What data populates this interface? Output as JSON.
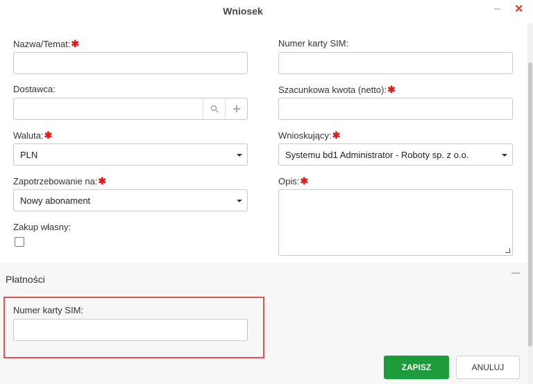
{
  "window": {
    "title": "Wniosek",
    "minimize": "–",
    "close": "✕"
  },
  "form": {
    "nazwa_label": "Nazwa/Temat:",
    "nazwa_value": "",
    "sim_label": "Numer karty SIM:",
    "sim_value": "",
    "dostawca_label": "Dostawca:",
    "dostawca_value": "",
    "kwota_label": "Szacunkowa kwota (netto):",
    "kwota_value": "",
    "waluta_label": "Waluta:",
    "waluta_value": "PLN",
    "wnioskujacy_label": "Wnioskujący:",
    "wnioskujacy_value": "Systemu bd1 Administrator - Roboty sp. z o.o.",
    "zapotrzebowanie_label": "Zapotrzebowanie na:",
    "zapotrzebowanie_value": "Nowy abonament",
    "opis_label": "Opis:",
    "opis_value": "",
    "zakup_label": "Zakup własny:",
    "zakup_checked": false,
    "required_mark": "✱"
  },
  "platnosci": {
    "title": "Płatności",
    "sim_label": "Numer karty SIM:",
    "sim_value": ""
  },
  "buttons": {
    "save": "ZAPISZ",
    "cancel": "ANULUJ"
  },
  "icons": {
    "search": "search-icon",
    "add": "plus-icon",
    "dropdown": "caret-down-icon",
    "close": "close-icon",
    "minimize": "minimize-icon"
  },
  "colors": {
    "required": "#e01b1b",
    "save_button": "#1e9b3a",
    "highlight_border": "#e05252"
  }
}
